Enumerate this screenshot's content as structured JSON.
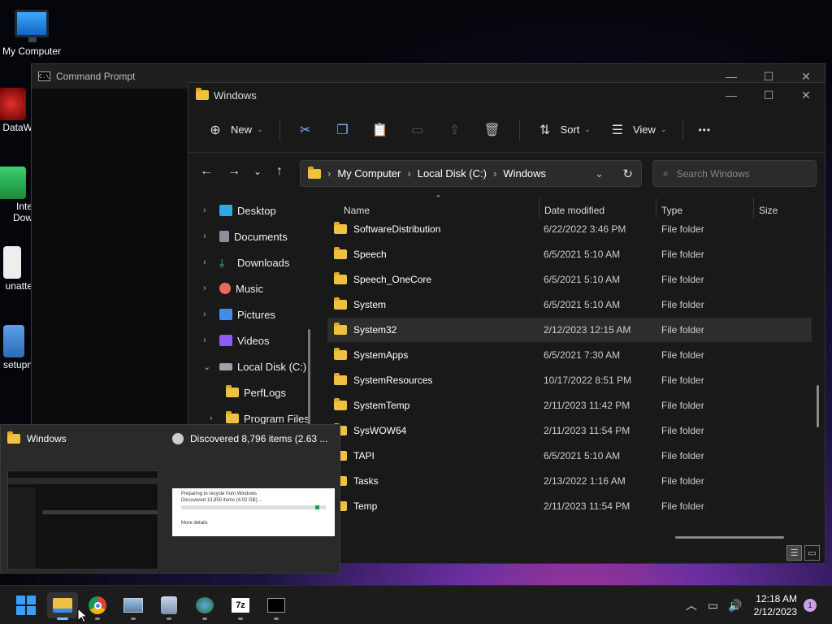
{
  "desktop": {
    "icons": [
      {
        "label": "My Computer"
      },
      {
        "label": "DataW"
      },
      {
        "label": "Inte Dow"
      },
      {
        "label": "unatte"
      },
      {
        "label": "setupn"
      }
    ]
  },
  "cmd": {
    "title": "Command Prompt",
    "icon_text": "C:\\",
    "controls": [
      "—",
      "☐",
      "✕"
    ]
  },
  "explorer": {
    "title": "Windows",
    "controls": [
      "—",
      "☐",
      "✕"
    ],
    "toolbar": {
      "new_label": "New",
      "sort_label": "Sort",
      "view_label": "View",
      "more_label": "•••"
    },
    "breadcrumb": [
      "My Computer",
      "Local Disk (C:)",
      "Windows"
    ],
    "search_placeholder": "Search Windows",
    "nav": [
      {
        "label": "Desktop",
        "color": "#2ea8e6"
      },
      {
        "label": "Documents",
        "color": "#8a8f99"
      },
      {
        "label": "Downloads",
        "color": "#2ecc71"
      },
      {
        "label": "Music",
        "color": "#e66b5a"
      },
      {
        "label": "Pictures",
        "color": "#3f8ee8"
      },
      {
        "label": "Videos",
        "color": "#8b5cf6"
      },
      {
        "label": "Local Disk (C:)",
        "color": "#9aa4b1"
      },
      {
        "label": "PerfLogs",
        "color": "#f0c040"
      },
      {
        "label": "Program Files",
        "color": "#f0c040"
      }
    ],
    "columns": {
      "name": "Name",
      "date": "Date modified",
      "type": "Type",
      "size": "Size"
    },
    "rows": [
      {
        "name": "SoftwareDistribution",
        "date": "6/22/2022 3:46 PM",
        "type": "File folder"
      },
      {
        "name": "Speech",
        "date": "6/5/2021 5:10 AM",
        "type": "File folder"
      },
      {
        "name": "Speech_OneCore",
        "date": "6/5/2021 5:10 AM",
        "type": "File folder"
      },
      {
        "name": "System",
        "date": "6/5/2021 5:10 AM",
        "type": "File folder"
      },
      {
        "name": "System32",
        "date": "2/12/2023 12:15 AM",
        "type": "File folder"
      },
      {
        "name": "SystemApps",
        "date": "6/5/2021 7:30 AM",
        "type": "File folder"
      },
      {
        "name": "SystemResources",
        "date": "10/17/2022 8:51 PM",
        "type": "File folder"
      },
      {
        "name": "SystemTemp",
        "date": "2/11/2023 11:42 PM",
        "type": "File folder"
      },
      {
        "name": "SysWOW64",
        "date": "2/11/2023 11:54 PM",
        "type": "File folder"
      },
      {
        "name": "TAPI",
        "date": "6/5/2021 5:10 AM",
        "type": "File folder"
      },
      {
        "name": "Tasks",
        "date": "2/13/2022 1:16 AM",
        "type": "File folder"
      },
      {
        "name": "Temp",
        "date": "2/11/2023 11:54 PM",
        "type": "File folder"
      }
    ]
  },
  "preview": {
    "win1_title": "Windows",
    "win2_title": "Discovered 8,796 items (2.63 ...",
    "thumb2_line1": "Preparing to recycle from Windows",
    "thumb2_line2": "Discovered 13,850 items (4.02 GB)...",
    "thumb2_more": "More details"
  },
  "taskbar": {
    "time": "12:18 AM",
    "date": "2/12/2023",
    "notification_count": "1",
    "apps": [
      "start-icon",
      "file-explorer-icon",
      "chrome-icon",
      "image-viewer-icon",
      "app-icon",
      "internet-download-manager-icon",
      "7zip-icon",
      "command-prompt-icon"
    ]
  }
}
